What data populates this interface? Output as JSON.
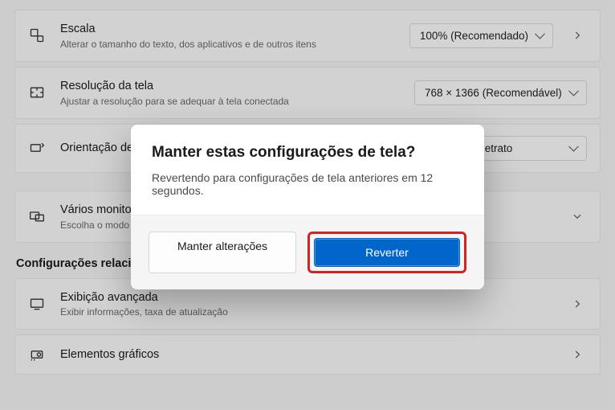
{
  "rows": {
    "scale": {
      "title": "Escala",
      "sub": "Alterar o tamanho do texto, dos aplicativos e de outros itens",
      "value": "100% (Recomendado)"
    },
    "resolution": {
      "title": "Resolução da tela",
      "sub": "Ajustar a resolução para se adequar à tela conectada",
      "value": "768 × 1366 (Recomendável)"
    },
    "orientation": {
      "title": "Orientação de exibição",
      "value": "Retrato"
    },
    "monitors": {
      "title": "Vários monitores",
      "sub": "Escolha o modo de apresentação dos seus monitores"
    },
    "advanced": {
      "title": "Exibição avançada",
      "sub": "Exibir informações, taxa de atualização"
    },
    "graphics": {
      "title": "Elementos gráficos"
    }
  },
  "section_heading": "Configurações relacionadas",
  "dialog": {
    "title": "Manter estas configurações de tela?",
    "message": "Revertendo para configurações de tela anteriores em 12 segundos.",
    "keep": "Manter alterações",
    "revert": "Reverter"
  }
}
